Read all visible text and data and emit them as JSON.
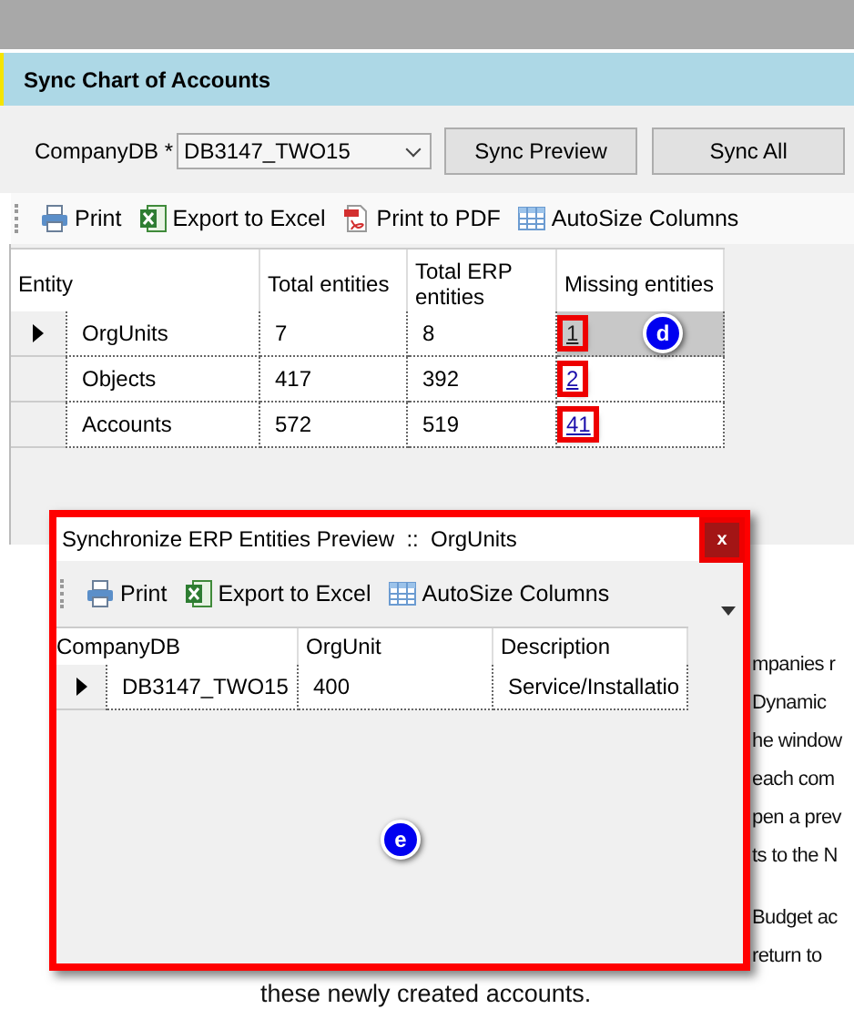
{
  "header": {
    "title": "Sync Chart of Accounts"
  },
  "filter": {
    "label": "CompanyDB *",
    "value": "DB3147_TWO15"
  },
  "buttons": [
    "Sync Preview",
    "Sync All"
  ],
  "toolbar": [
    {
      "kind": "print",
      "label": "Print"
    },
    {
      "kind": "excel",
      "label": "Export to Excel"
    },
    {
      "kind": "pdf",
      "label": "Print to PDF"
    },
    {
      "kind": "grid",
      "label": "AutoSize Columns"
    }
  ],
  "table": {
    "columns": [
      "Entity",
      "Total entities",
      "Total ERP entities",
      "Missing entities"
    ],
    "rows": [
      {
        "selected": true,
        "cells": [
          "OrgUnits",
          "7",
          "8"
        ],
        "missing": "1",
        "highlighted": true
      },
      {
        "selected": false,
        "cells": [
          "Objects",
          "417",
          "392"
        ],
        "missing": "2",
        "highlighted": true
      },
      {
        "selected": false,
        "cells": [
          "Accounts",
          "572",
          "519"
        ],
        "missing": "41",
        "highlighted": true
      }
    ],
    "callout": "d"
  },
  "document": {
    "lines": [
      "mpanies r",
      "Dynamic",
      "he window",
      "each com",
      "pen a prev",
      "ts to the N"
    ],
    "lines_2": [
      "Budget ac",
      "return to"
    ],
    "last_line": "these newly created accounts."
  },
  "popup": {
    "title": "Synchronize ERP Entities Preview  ::  OrgUnits",
    "highlighted": true,
    "close": {
      "label": "x",
      "highlighted": true
    },
    "toolbar": [
      {
        "kind": "print",
        "label": "Print"
      },
      {
        "kind": "excel",
        "label": "Export to Excel"
      },
      {
        "kind": "grid",
        "label": "AutoSize Columns"
      }
    ],
    "table": {
      "columns": [
        "CompanyDB",
        "OrgUnit",
        "Description"
      ],
      "rows": [
        {
          "selected": true,
          "cells": [
            "DB3147_TWO15",
            "400",
            "Service/Installatio"
          ]
        }
      ]
    },
    "callout": "e"
  }
}
